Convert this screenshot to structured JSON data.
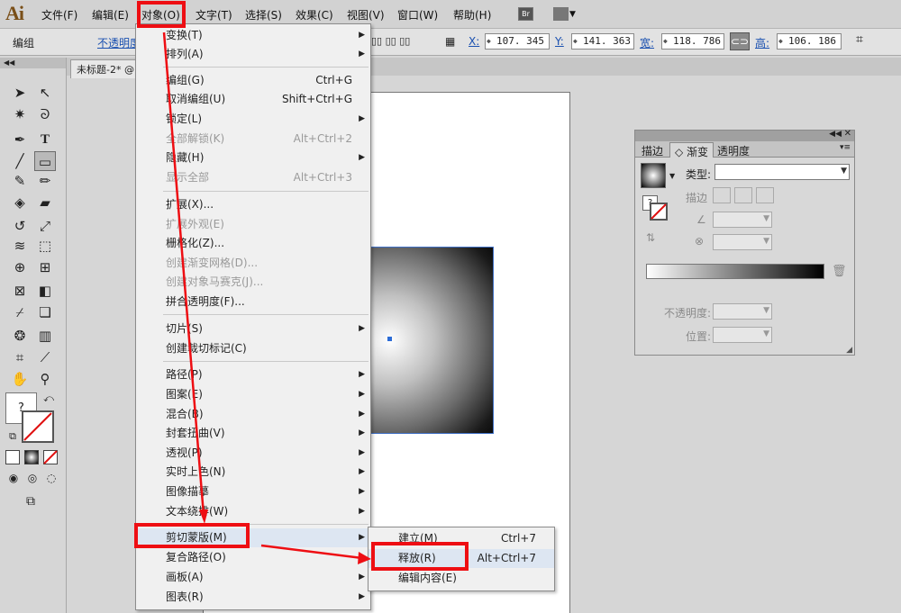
{
  "app": {
    "logo": "Ai"
  },
  "menubar": {
    "items": [
      "文件(F)",
      "编辑(E)",
      "对象(O)",
      "文字(T)",
      "选择(S)",
      "效果(C)",
      "视图(V)",
      "窗口(W)",
      "帮助(H)"
    ],
    "bridge_label": "Br"
  },
  "control_bar": {
    "group_label": "编组",
    "opacity_label": "不透明度",
    "x_label": "X:",
    "x_value": "107. 345",
    "y_label": "Y:",
    "y_value": "141. 363",
    "w_label": "宽:",
    "w_value": "118. 786",
    "h_label": "高:",
    "h_value": "106. 186"
  },
  "document": {
    "tab_title": "未标题-2* @"
  },
  "object_menu": {
    "items": [
      {
        "label": "变换(T)",
        "shortcut": "",
        "submenu": true,
        "disabled": false
      },
      {
        "label": "排列(A)",
        "shortcut": "",
        "submenu": true,
        "disabled": false
      },
      {
        "label": "编组(G)",
        "shortcut": "Ctrl+G",
        "submenu": false,
        "disabled": false
      },
      {
        "label": "取消编组(U)",
        "shortcut": "Shift+Ctrl+G",
        "submenu": false,
        "disabled": false
      },
      {
        "label": "锁定(L)",
        "shortcut": "",
        "submenu": true,
        "disabled": false
      },
      {
        "label": "全部解锁(K)",
        "shortcut": "Alt+Ctrl+2",
        "submenu": false,
        "disabled": true
      },
      {
        "label": "隐藏(H)",
        "shortcut": "",
        "submenu": true,
        "disabled": false
      },
      {
        "label": "显示全部",
        "shortcut": "Alt+Ctrl+3",
        "submenu": false,
        "disabled": true
      },
      {
        "label": "扩展(X)...",
        "shortcut": "",
        "submenu": false,
        "disabled": false
      },
      {
        "label": "扩展外观(E)",
        "shortcut": "",
        "submenu": false,
        "disabled": true
      },
      {
        "label": "栅格化(Z)...",
        "shortcut": "",
        "submenu": false,
        "disabled": false
      },
      {
        "label": "创建渐变网格(D)...",
        "shortcut": "",
        "submenu": false,
        "disabled": true
      },
      {
        "label": "创建对象马赛克(J)...",
        "shortcut": "",
        "submenu": false,
        "disabled": true
      },
      {
        "label": "拼合透明度(F)...",
        "shortcut": "",
        "submenu": false,
        "disabled": false
      },
      {
        "label": "切片(S)",
        "shortcut": "",
        "submenu": true,
        "disabled": false
      },
      {
        "label": "创建裁切标记(C)",
        "shortcut": "",
        "submenu": false,
        "disabled": false
      },
      {
        "label": "路径(P)",
        "shortcut": "",
        "submenu": true,
        "disabled": false
      },
      {
        "label": "图案(E)",
        "shortcut": "",
        "submenu": true,
        "disabled": false
      },
      {
        "label": "混合(B)",
        "shortcut": "",
        "submenu": true,
        "disabled": false
      },
      {
        "label": "封套扭曲(V)",
        "shortcut": "",
        "submenu": true,
        "disabled": false
      },
      {
        "label": "透视(P)",
        "shortcut": "",
        "submenu": true,
        "disabled": false
      },
      {
        "label": "实时上色(N)",
        "shortcut": "",
        "submenu": true,
        "disabled": false
      },
      {
        "label": "图像描摹",
        "shortcut": "",
        "submenu": true,
        "disabled": false
      },
      {
        "label": "文本绕排(W)",
        "shortcut": "",
        "submenu": true,
        "disabled": false
      },
      {
        "label": "剪切蒙版(M)",
        "shortcut": "",
        "submenu": true,
        "disabled": false
      },
      {
        "label": "复合路径(O)",
        "shortcut": "",
        "submenu": true,
        "disabled": false
      },
      {
        "label": "画板(A)",
        "shortcut": "",
        "submenu": true,
        "disabled": false
      },
      {
        "label": "图表(R)",
        "shortcut": "",
        "submenu": true,
        "disabled": false
      }
    ]
  },
  "clipping_submenu": {
    "items": [
      {
        "label": "建立(M)",
        "shortcut": "Ctrl+7"
      },
      {
        "label": "释放(R)",
        "shortcut": "Alt+Ctrl+7"
      },
      {
        "label": "编辑内容(E)",
        "shortcut": ""
      }
    ]
  },
  "gradient_panel": {
    "tabs": [
      "描边",
      "◇ 渐变",
      "透明度"
    ],
    "type_label": "类型:",
    "stroke_label": "描边",
    "opacity_label": "不透明度:",
    "location_label": "位置:",
    "fill_question": "?"
  },
  "tools": {
    "fill_question": "?"
  },
  "colors": {
    "highlight_red": "#ee0e13",
    "selection_blue": "#3f6fc4"
  }
}
